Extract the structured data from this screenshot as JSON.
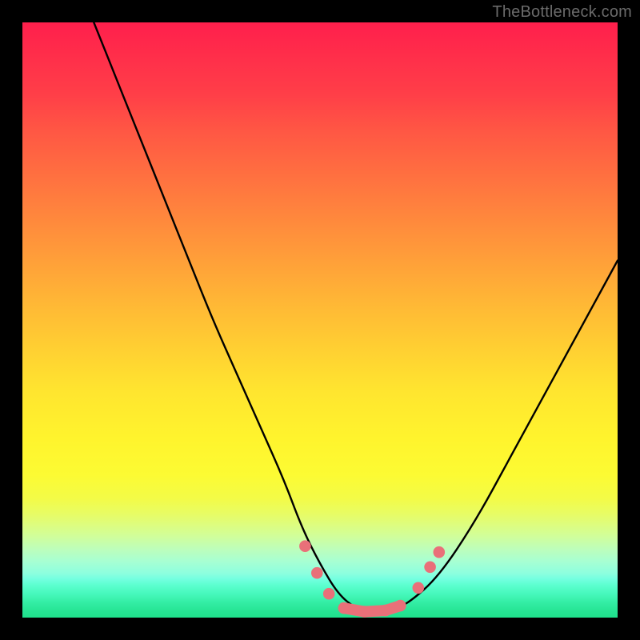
{
  "watermark": "TheBottleneck.com",
  "chart_data": {
    "type": "line",
    "title": "",
    "xlabel": "",
    "ylabel": "",
    "xlim": [
      0,
      100
    ],
    "ylim": [
      0,
      100
    ],
    "grid": false,
    "legend": false,
    "background": "rainbow-gradient",
    "series": [
      {
        "name": "bottleneck-curve",
        "x": [
          12,
          16,
          20,
          24,
          28,
          32,
          36,
          40,
          44,
          47,
          50,
          53,
          56,
          59,
          62,
          65,
          70,
          76,
          82,
          88,
          94,
          100
        ],
        "y": [
          100,
          90,
          80,
          70,
          60,
          50,
          41,
          32,
          23,
          15,
          9,
          4,
          1.5,
          1,
          1.2,
          2.5,
          7,
          16,
          27,
          38,
          49,
          60
        ]
      }
    ],
    "markers": [
      {
        "name": "left-marker-1",
        "x": 47.5,
        "y": 12,
        "r": 1.3
      },
      {
        "name": "left-marker-2",
        "x": 49.5,
        "y": 7.5,
        "r": 1.3
      },
      {
        "name": "left-marker-3",
        "x": 51.5,
        "y": 4,
        "r": 1.3
      },
      {
        "name": "mid-bar-left",
        "x": 54,
        "y": 1.6,
        "r": 1.3
      },
      {
        "name": "mid-bar-center",
        "x": 57.5,
        "y": 1.0,
        "r": 1.3
      },
      {
        "name": "mid-bar-right-a",
        "x": 61,
        "y": 1.2,
        "r": 1.3
      },
      {
        "name": "mid-bar-right-b",
        "x": 63.5,
        "y": 2.0,
        "r": 1.3
      },
      {
        "name": "right-marker-1",
        "x": 66.5,
        "y": 5,
        "r": 1.3
      },
      {
        "name": "right-marker-2",
        "x": 68.5,
        "y": 8.5,
        "r": 1.3
      },
      {
        "name": "right-marker-3",
        "x": 70,
        "y": 11,
        "r": 1.3
      }
    ],
    "marker_color": "#e97079",
    "curve_color": "#000000"
  }
}
